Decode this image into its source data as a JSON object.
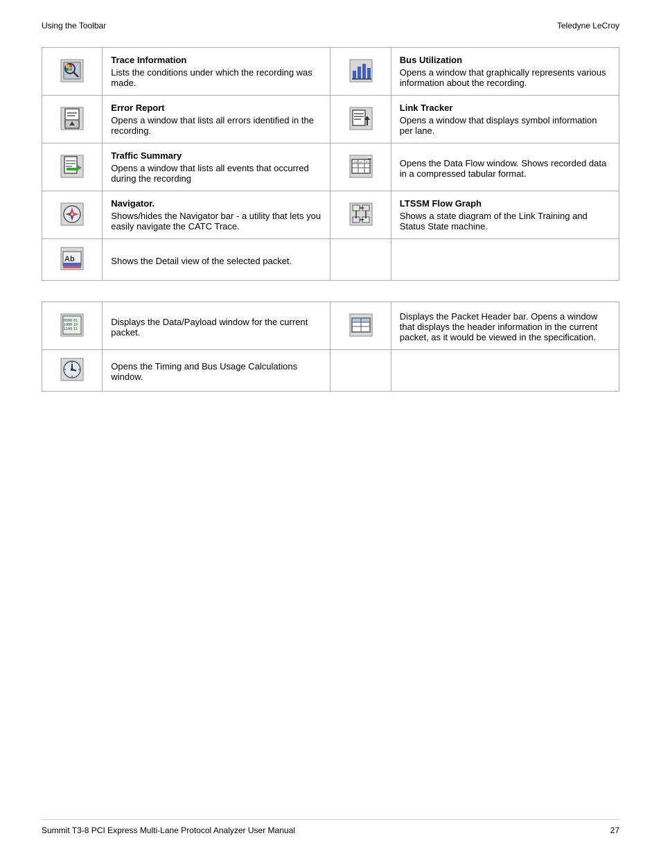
{
  "header": {
    "left": "Using the Toolbar",
    "right": "Teledyne LeCroy"
  },
  "footer": {
    "left": "Summit T3-8 PCI Express Multi-Lane Protocol Analyzer User Manual",
    "right": "27"
  },
  "table1": {
    "rows": [
      {
        "left_icon": "trace-info-icon",
        "left_title": "Trace Information",
        "left_desc": "Lists the conditions under which the recording was made.",
        "right_icon": "bus-util-icon",
        "right_title": "Bus Utilization",
        "right_desc": "Opens a window that graphically represents various information about the recording."
      },
      {
        "left_icon": "error-report-icon",
        "left_title": "Error Report",
        "left_desc": "Opens a window that lists all errors identified in the recording.",
        "right_icon": "link-tracker-icon",
        "right_title": "Link Tracker",
        "right_desc": "Opens a window that displays symbol information per lane."
      },
      {
        "left_icon": "traffic-summary-icon",
        "left_title": "Traffic Summary",
        "left_desc": "Opens a window that lists all events that occurred during the recording",
        "right_icon": "data-flow-icon",
        "right_title": "",
        "right_desc": "Opens the Data Flow window. Shows recorded data in a compressed tabular format."
      },
      {
        "left_icon": "navigator-icon",
        "left_title": "Navigator.",
        "left_desc": "Shows/hides the Navigator bar - a utility that lets you easily navigate the CATC Trace.",
        "right_icon": "ltssm-icon",
        "right_title": "LTSSM Flow Graph",
        "right_desc": "Shows a state diagram of the Link Training and Status State machine."
      },
      {
        "left_icon": "detail-view-icon",
        "left_title": "",
        "left_desc": "Shows the Detail view of the selected packet.",
        "right_icon": "",
        "right_title": "",
        "right_desc": ""
      }
    ]
  },
  "table2": {
    "rows": [
      {
        "left_icon": "data-payload-icon",
        "left_title": "",
        "left_desc": "Displays the Data/Payload window for the current packet.",
        "right_icon": "packet-header-icon",
        "right_title": "",
        "right_desc": "Displays the Packet Header bar. Opens a window that displays the header information in the current packet, as it would be viewed in the specification."
      },
      {
        "left_icon": "timing-bus-icon",
        "left_title": "",
        "left_desc": "Opens the Timing and Bus Usage Calculations window.",
        "right_icon": "",
        "right_title": "",
        "right_desc": ""
      }
    ]
  }
}
